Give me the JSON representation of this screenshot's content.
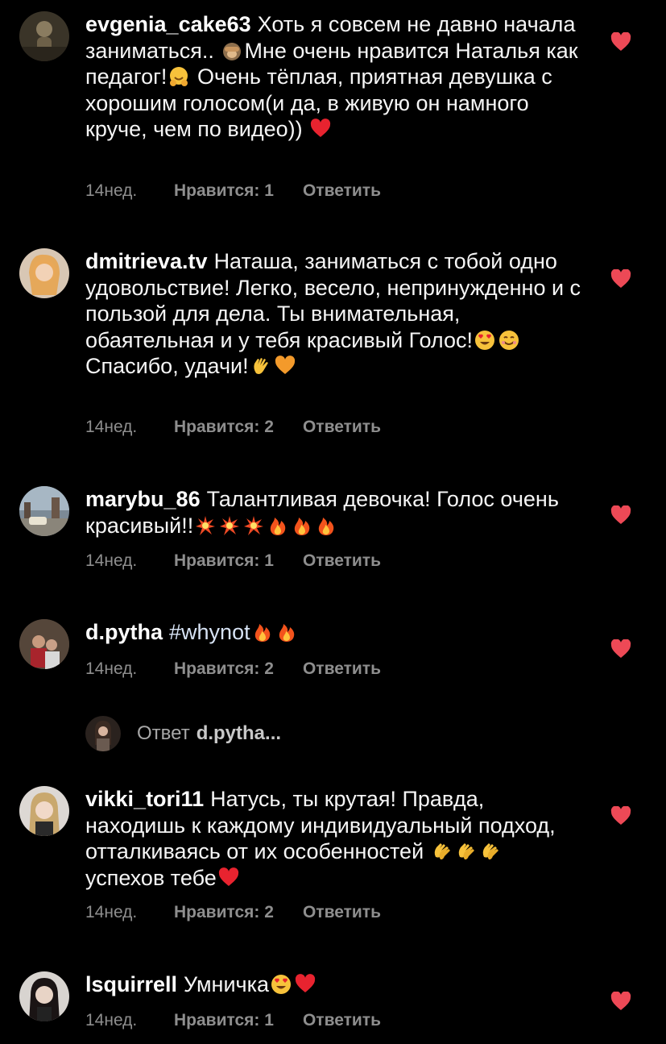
{
  "colors": {
    "background": "#000000",
    "text": "#ffffff",
    "muted": "#8e8e8e",
    "heart": "#ed4956"
  },
  "comments": [
    {
      "username": "evgenia_cake63",
      "text_1": "Хоть я совсем не давно начала заниматься.. ",
      "emoji_1": "see-no-evil-monkey-emoji",
      "text_2": "Мне очень нравится Наталья как педагог!",
      "emoji_2": "hugging-face-emoji",
      "text_3": " Очень тёплая, приятная девушка с хорошим голосом(и да, в живую он намного круче, чем по видео)) ",
      "emoji_3": "red-heart-emoji",
      "time": "14нед.",
      "likes": "Нравится: 1",
      "reply": "Ответить"
    },
    {
      "username": "dmitrieva.tv",
      "text_1": "Наташа, заниматься с тобой одно удовольствие! Легко, весело, непринужденно и с пользой для дела. Ты внимательная,  обаятельная и  у тебя красивый Голос!",
      "emoji_1": "heart-eyes-emoji",
      "emoji_2": "smiling-face-emoji",
      "text_2": " Спасибо, удачи!",
      "emoji_3": "waving-hand-emoji",
      "emoji_4": "orange-heart-emoji",
      "time": "14нед.",
      "likes": "Нравится: 2",
      "reply": "Ответить"
    },
    {
      "username": "marybu_86",
      "text_1": "Талантливая девочка! Голос очень красивый!!",
      "emoji_1": "collision-emoji",
      "emoji_2": "fire-emoji",
      "time": "14нед.",
      "likes": "Нравится: 1",
      "reply": "Ответить"
    },
    {
      "username": "d.pytha",
      "hashtag": "#whynot",
      "emoji_1": "fire-emoji",
      "time": "14нед.",
      "likes": "Нравится: 2",
      "reply": "Ответить"
    },
    {
      "username": "vikki_tori11",
      "text_1": "Натусь, ты крутая! Правда, находишь к каждому индивидуальный подход, отталкиваясь от их особенностей ",
      "emoji_1": "clapping-hands-emoji",
      "text_2": " успехов тебе",
      "emoji_2": "red-heart-emoji",
      "time": "14нед.",
      "likes": "Нравится: 2",
      "reply": "Ответить"
    },
    {
      "username": "lsquirrell",
      "text_1": "Умничка",
      "emoji_1": "heart-eyes-emoji",
      "emoji_2": "red-heart-emoji",
      "time": "14нед.",
      "likes": "Нравится: 1",
      "reply": "Ответить"
    }
  ],
  "reply_thread": {
    "label": "Ответ",
    "username": "d.pytha..."
  }
}
